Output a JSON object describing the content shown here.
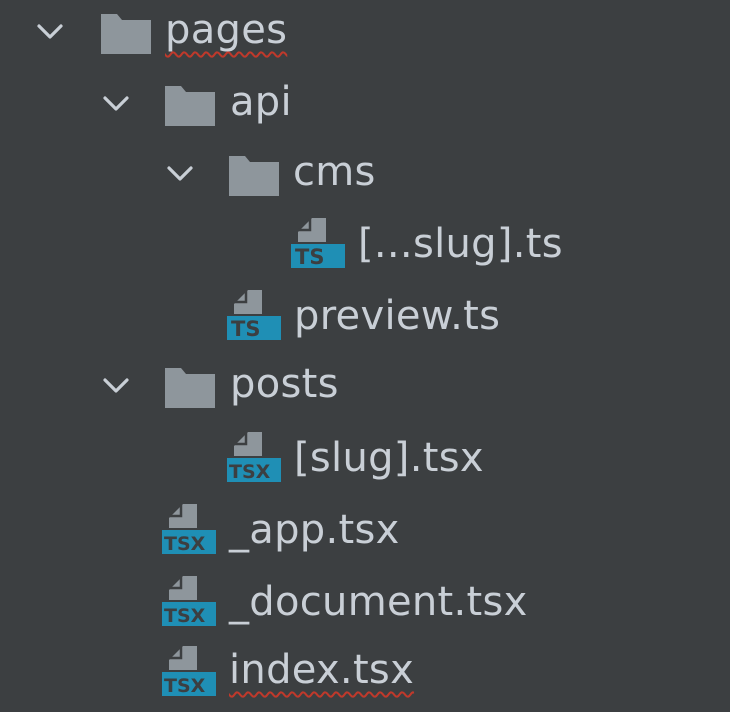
{
  "colors": {
    "background": "#3c3f41",
    "text": "#c9cfd6",
    "folder": "#8e969c",
    "file_badge": "#1f8fb5",
    "chevron": "#c9cfd6",
    "spell_error": "#c0392b"
  },
  "tree": [
    {
      "label": "pages",
      "type": "folder",
      "expanded": true,
      "icon": "folder-icon",
      "spell_error": true
    },
    {
      "label": "api",
      "type": "folder",
      "expanded": true,
      "icon": "folder-icon"
    },
    {
      "label": "cms",
      "type": "folder",
      "expanded": true,
      "icon": "folder-icon"
    },
    {
      "label": "[...slug].ts",
      "type": "file",
      "badge": "TS",
      "icon": "typescript-file-icon"
    },
    {
      "label": "preview.ts",
      "type": "file",
      "badge": "TS",
      "icon": "typescript-file-icon"
    },
    {
      "label": "posts",
      "type": "folder",
      "expanded": true,
      "icon": "folder-icon"
    },
    {
      "label": "[slug].tsx",
      "type": "file",
      "badge": "TSX",
      "icon": "tsx-file-icon"
    },
    {
      "label": "_app.tsx",
      "type": "file",
      "badge": "TSX",
      "icon": "tsx-file-icon"
    },
    {
      "label": "_document.tsx",
      "type": "file",
      "badge": "TSX",
      "icon": "tsx-file-icon"
    },
    {
      "label": "index.tsx",
      "type": "file",
      "badge": "TSX",
      "icon": "tsx-file-icon",
      "spell_error": true
    }
  ]
}
